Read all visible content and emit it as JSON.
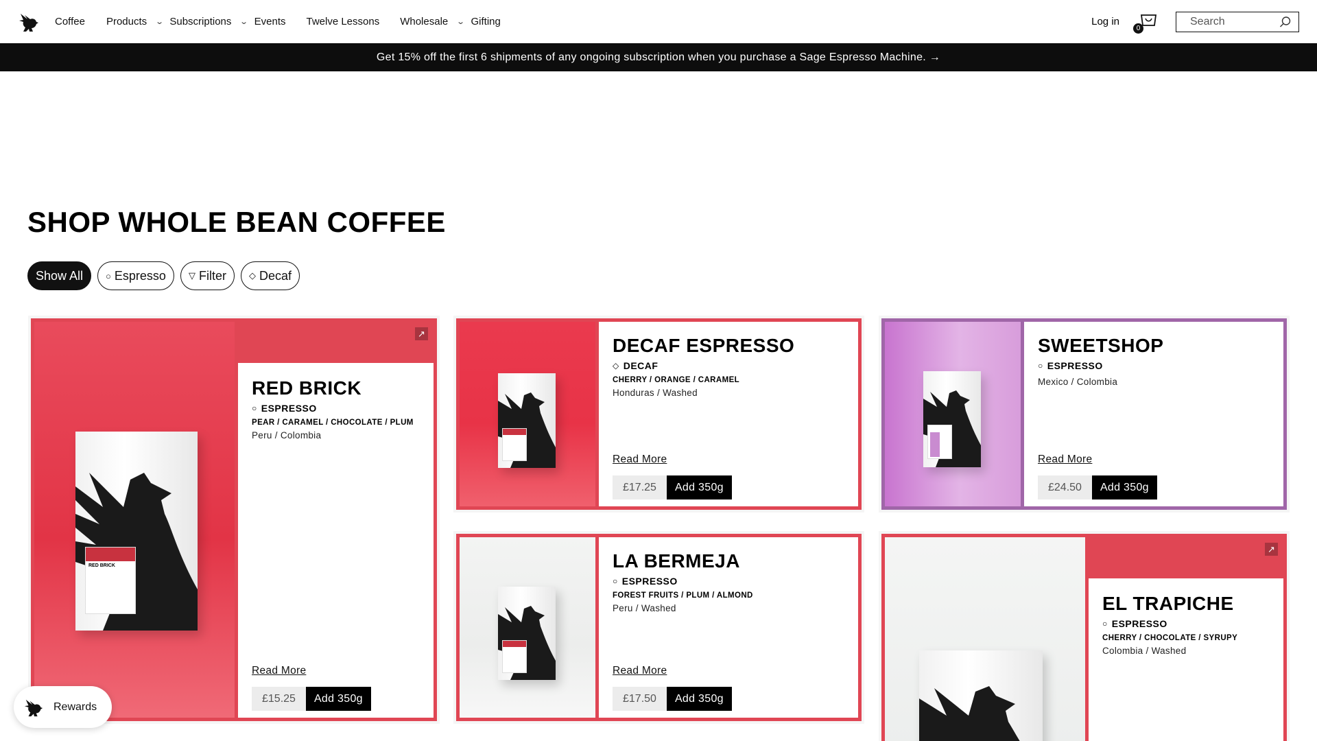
{
  "header": {
    "nav": [
      {
        "label": "Coffee",
        "dropdown": false
      },
      {
        "label": "Products",
        "dropdown": true
      },
      {
        "label": "Subscriptions",
        "dropdown": true
      },
      {
        "label": "Events",
        "dropdown": false
      },
      {
        "label": "Twelve Lessons",
        "dropdown": false
      },
      {
        "label": "Wholesale",
        "dropdown": true
      },
      {
        "label": "Gifting",
        "dropdown": false
      }
    ],
    "login": "Log in",
    "cart_count": "0",
    "search_placeholder": "Search"
  },
  "announcement": "Get 15% off the first 6 shipments of any ongoing subscription when you purchase a Sage Espresso Machine. →",
  "title": "SHOP WHOLE BEAN COFFEE",
  "filters": [
    {
      "label": "Show All",
      "symbol": "",
      "active": true
    },
    {
      "label": "Espresso",
      "symbol": "○",
      "active": false
    },
    {
      "label": "Filter",
      "symbol": "▽",
      "active": false
    },
    {
      "label": "Decaf",
      "symbol": "◇",
      "active": false
    }
  ],
  "products": [
    {
      "name": "RED BRICK",
      "type": "ESPRESSO",
      "symbol": "○",
      "notes": "PEAR / CARAMEL / CHOCOLATE / PLUM",
      "origin": "Peru / Colombia",
      "read_more": "Read More",
      "price": "£15.25",
      "add": "Add 350g",
      "color": "#e04654",
      "bag_label": "RED BRICK"
    },
    {
      "name": "DECAF ESPRESSO",
      "type": "DECAF",
      "symbol": "◇",
      "notes": "CHERRY / ORANGE / CARAMEL",
      "origin": "Honduras / Washed",
      "read_more": "Read More",
      "price": "£17.25",
      "add": "Add 350g",
      "color": "#e04654"
    },
    {
      "name": "SWEETSHOP",
      "type": "ESPRESSO",
      "symbol": "○",
      "notes": "",
      "origin": "Mexico / Colombia",
      "read_more": "Read More",
      "price": "£24.50",
      "add": "Add 350g",
      "color": "#a066a8"
    },
    {
      "name": "LA BERMEJA",
      "type": "ESPRESSO",
      "symbol": "○",
      "notes": "FOREST FRUITS / PLUM / ALMOND",
      "origin": "Peru / Washed",
      "read_more": "Read More",
      "price": "£17.50",
      "add": "Add 350g",
      "color": "#e04654"
    },
    {
      "name": "EL TRAPICHE",
      "type": "ESPRESSO",
      "symbol": "○",
      "notes": "CHERRY / CHOCOLATE / SYRUPY",
      "origin": "Colombia / Washed",
      "color": "#e04654"
    }
  ],
  "rewards": "Rewards"
}
